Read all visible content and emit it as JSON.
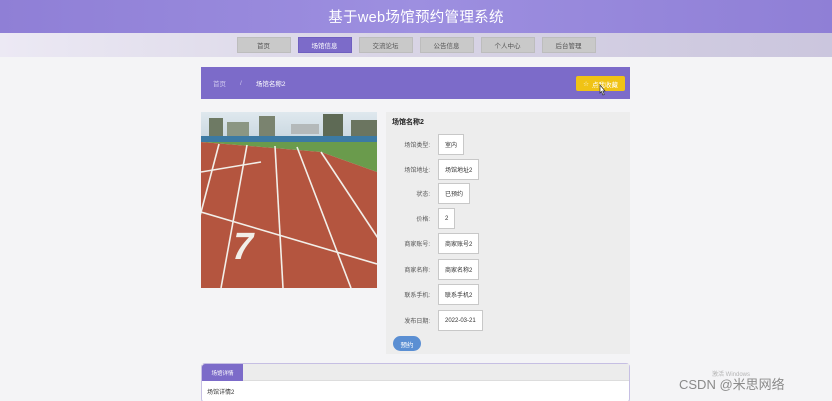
{
  "header": {
    "site_title": "基于web场馆预约管理系统"
  },
  "nav": {
    "items": [
      {
        "label": "首页",
        "active": false
      },
      {
        "label": "场馆信息",
        "active": true
      },
      {
        "label": "交流论坛",
        "active": false
      },
      {
        "label": "公告信息",
        "active": false
      },
      {
        "label": "个人中心",
        "active": false
      },
      {
        "label": "后台管理",
        "active": false
      }
    ]
  },
  "breadcrumb": {
    "home": "首页",
    "separator": "/",
    "current": "场馆名称2"
  },
  "favorite_button": {
    "icon": "star-icon",
    "label": "点我收藏"
  },
  "venue": {
    "image_alt": "running-track-lane-7",
    "title": "场馆名称2",
    "fields": [
      {
        "label": "场馆类型:",
        "value": "室内"
      },
      {
        "label": "场馆地址:",
        "value": "场馆地址2"
      },
      {
        "label": "状态:",
        "value": "已预约"
      },
      {
        "label": "价格:",
        "value": "2"
      },
      {
        "label": "商家账号:",
        "value": "商家账号2"
      },
      {
        "label": "商家名称:",
        "value": "商家名称2"
      },
      {
        "label": "联系手机:",
        "value": "联系手机2"
      },
      {
        "label": "发布日期:",
        "value": "2022-03-21"
      }
    ],
    "book_label": "预约"
  },
  "detail": {
    "tab_label": "场馆详情",
    "text": "场馆详情2"
  },
  "watermarks": {
    "windows": "激活 Windows",
    "csdn": "CSDN @米思网络"
  },
  "colors": {
    "primary": "#7c6bc9",
    "accent": "#f0c315",
    "book": "#5b8fd3"
  }
}
